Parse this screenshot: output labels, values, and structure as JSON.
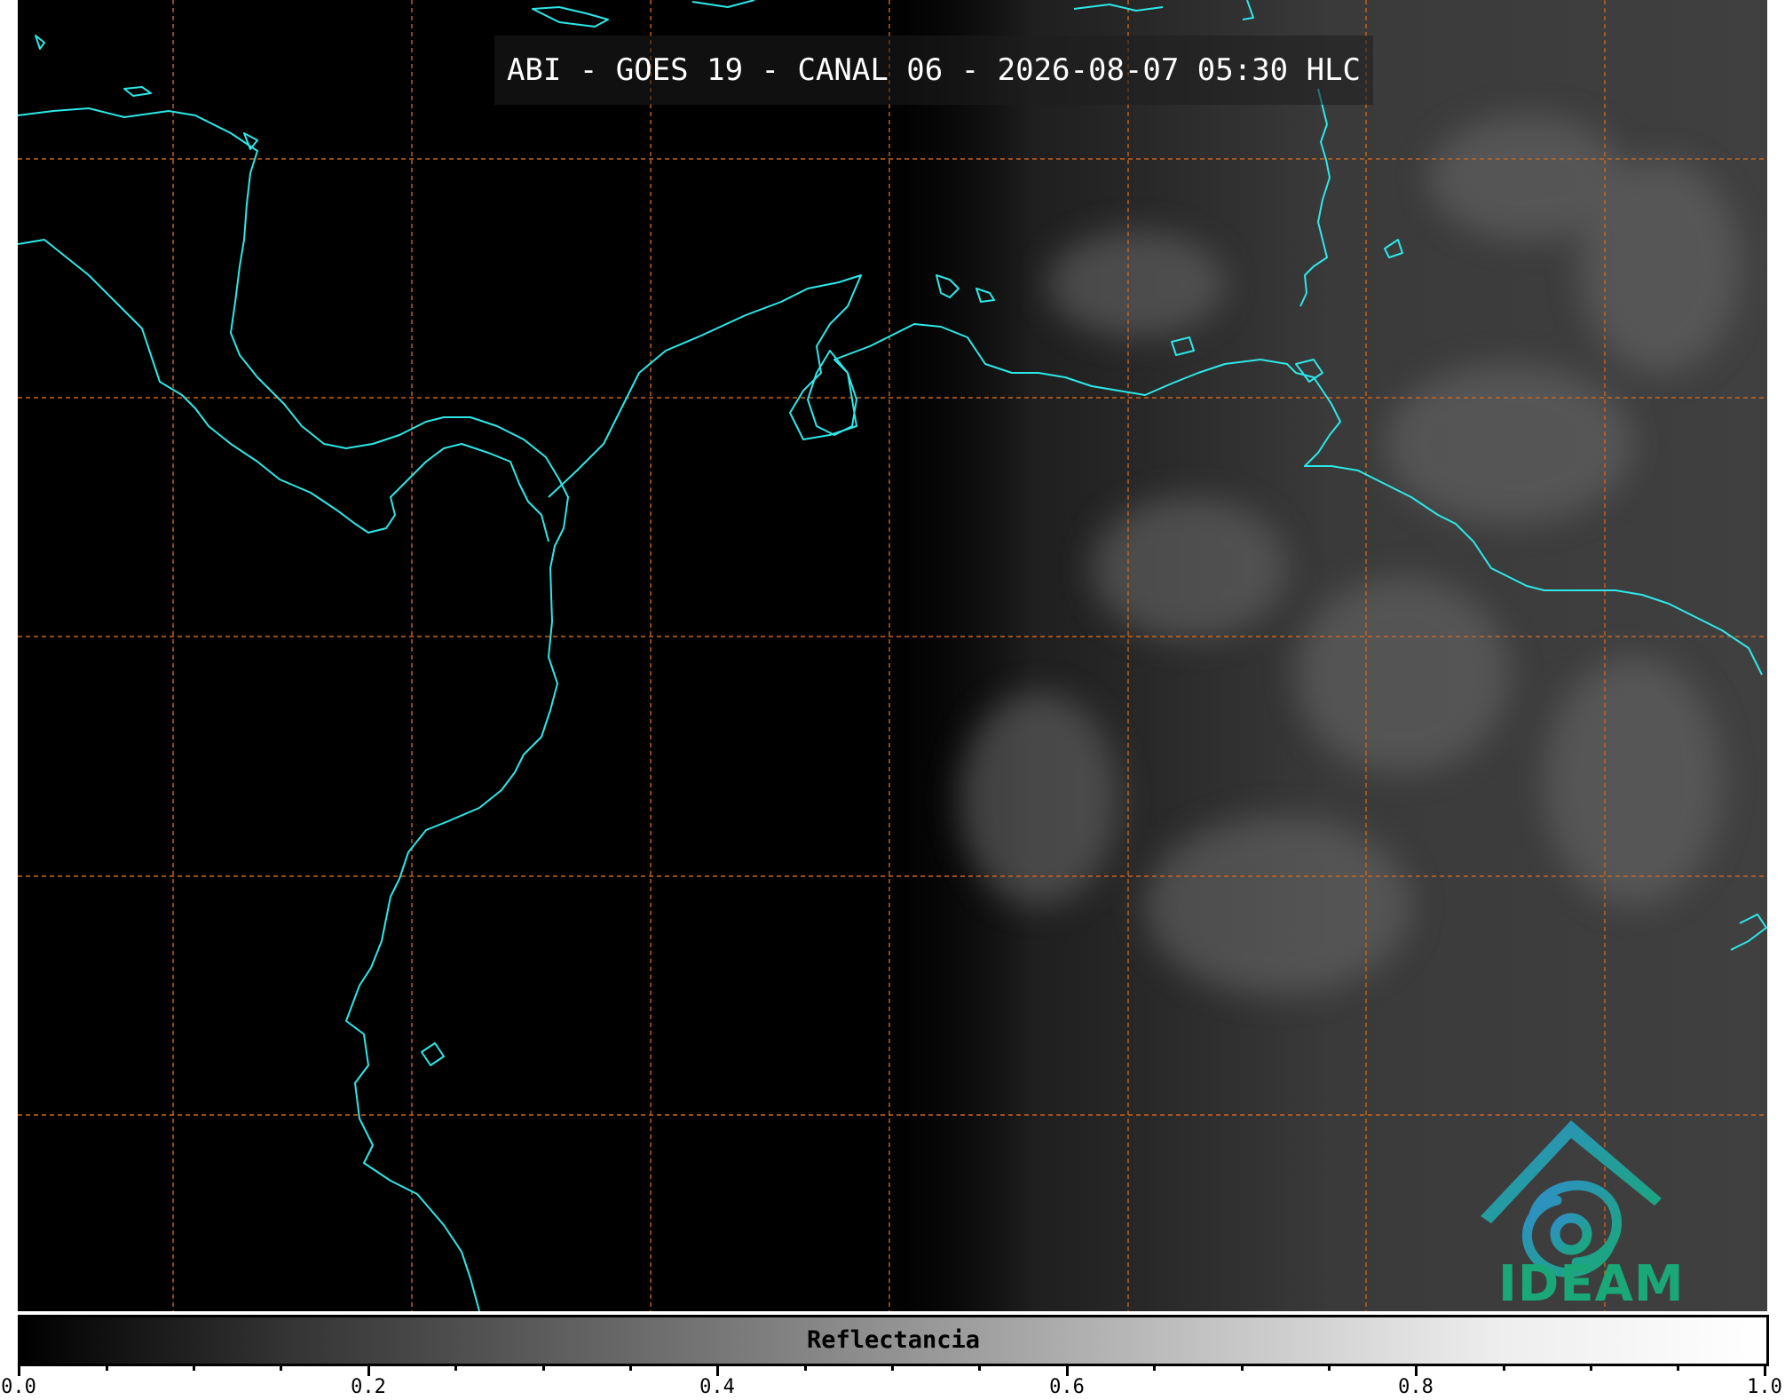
{
  "map": {
    "title": "ABI - GOES 19 - CANAL 06 - 2026-08-07 05:30 HLC",
    "coastline_color": "#2ee8e8",
    "grid_color": "#c8641e",
    "background_color": "#000000"
  },
  "logo": {
    "text": "IDEAM",
    "primary_color": "#1aa878",
    "secondary_color": "#2f8fc8"
  },
  "colorbar": {
    "label": "Reflectancia",
    "range": [
      0.0,
      1.0
    ],
    "tick_labels": [
      "0.0",
      "0.2",
      "0.4",
      "0.6",
      "0.8",
      "1.0"
    ]
  }
}
